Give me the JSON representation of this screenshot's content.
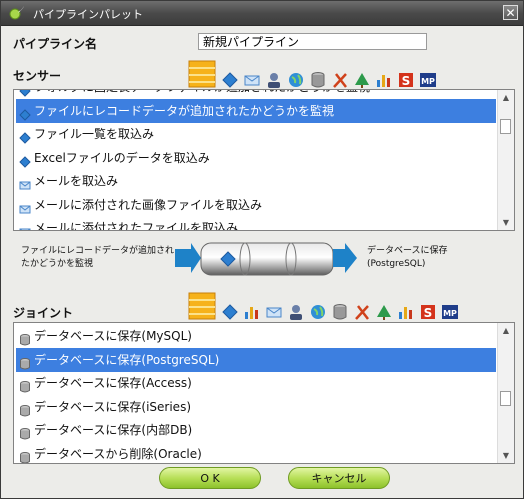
{
  "window": {
    "title": "パイプラインパレット",
    "close_glyph": "✕"
  },
  "pipeline_name": {
    "label": "パイプライン名",
    "value": "新規パイプライン"
  },
  "sensor": {
    "label": "センサー",
    "category_icons": [
      "pipeline-icon",
      "diamond-icon",
      "envelope-icon",
      "user-icon",
      "globe-icon",
      "database-icon",
      "tools-icon",
      "tree-icon",
      "chart-icon",
      "s-icon",
      "mp-icon"
    ],
    "items": [
      {
        "text": "フォルダに固定長データファイルが追加されたかどうかを監視",
        "icon": "diamond"
      },
      {
        "text": "ファイルにレコードデータが追加されたかどうかを監視",
        "icon": "diamond",
        "selected": true
      },
      {
        "text": "ファイル一覧を取込み",
        "icon": "diamond"
      },
      {
        "text": "Excelファイルのデータを取込み",
        "icon": "diamond"
      },
      {
        "text": "メールを取込み",
        "icon": "envelope"
      },
      {
        "text": "メールに添付された画像ファイルを取込み",
        "icon": "envelope"
      },
      {
        "text": "メールに添付されたファイルを取込み",
        "icon": "envelope"
      }
    ]
  },
  "flow": {
    "left_text": "ファイルにレコードデータが追加され\nたかどうかを監視",
    "right_text": "データベースに保存\n(PostgreSQL)"
  },
  "joint": {
    "label": "ジョイント",
    "category_icons": [
      "pipeline-icon",
      "diamond-icon",
      "chart-icon",
      "envelope-icon",
      "user-icon",
      "globe-icon",
      "database-icon",
      "tools-icon",
      "tree-icon",
      "chart-icon",
      "s-icon",
      "mp-icon"
    ],
    "items": [
      {
        "text": "データベースに保存(MySQL)",
        "icon": "database"
      },
      {
        "text": "データベースに保存(PostgreSQL)",
        "icon": "database",
        "selected": true
      },
      {
        "text": "データベースに保存(Access)",
        "icon": "database"
      },
      {
        "text": "データベースに保存(iSeries)",
        "icon": "database"
      },
      {
        "text": "データベースに保存(内部DB)",
        "icon": "database"
      },
      {
        "text": "データベースから削除(Oracle)",
        "icon": "database"
      }
    ]
  },
  "buttons": {
    "ok": "O K",
    "cancel": "キャンセル"
  },
  "colors": {
    "selection": "#3d7fe0",
    "button_green": "#b8df58",
    "titlebar": "#4a4a4a"
  }
}
